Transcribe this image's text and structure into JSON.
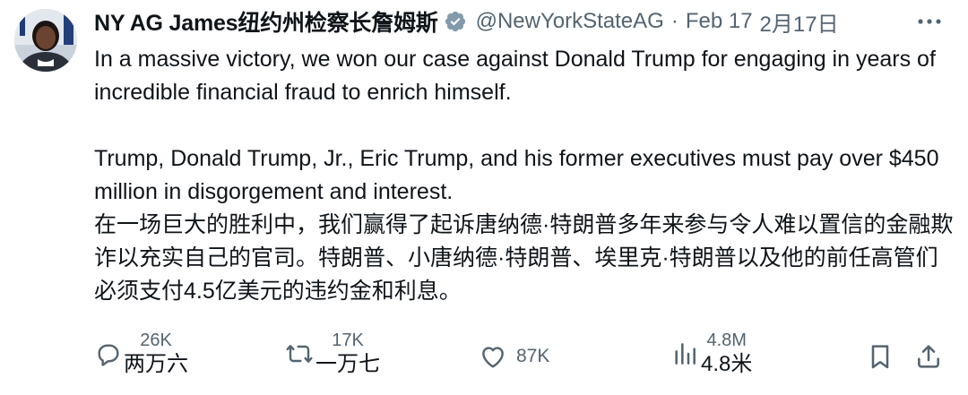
{
  "author": {
    "display_name": "NY AG James纽约州检察长詹姆斯",
    "handle": "@NewYorkStateAG",
    "separator": "·",
    "date": "Feb 17",
    "date_cn": "2月17日"
  },
  "tweet": {
    "paragraph1": "In a massive victory, we won our case against Donald Trump for engaging in years of incredible financial fraud to enrich himself.",
    "paragraph2": "Trump, Donald Trump, Jr., Eric Trump, and his former executives must pay over $450 million in disgorgement and interest.",
    "paragraph3": "在一场巨大的胜利中，我们赢得了起诉唐纳德·特朗普多年来参与令人难以置信的金融欺诈以充实自己的官司。特朗普、小唐纳德·特朗普、埃里克·特朗普以及他的前任高管们必须支付4.5亿美元的违约金和利息。"
  },
  "actions": {
    "replies": {
      "count": "26K",
      "count_cn": "两万六",
      "icon": "reply-icon"
    },
    "retweets": {
      "count": "17K",
      "count_cn": "一万七",
      "icon": "retweet-icon"
    },
    "likes": {
      "count": "87K",
      "icon": "heart-icon"
    },
    "views": {
      "count": "4.8M",
      "count_cn": "4.8米",
      "icon": "views-chart-icon"
    },
    "bookmark": {
      "icon": "bookmark-icon"
    },
    "share": {
      "icon": "share-icon"
    }
  },
  "colors": {
    "text_primary": "#0f1419",
    "text_secondary": "#536471",
    "verified_badge": "#829aab",
    "background": "#ffffff"
  }
}
